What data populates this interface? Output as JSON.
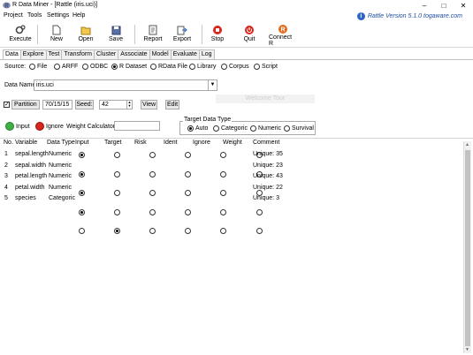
{
  "window": {
    "title": "R Data Miner - [Rattle (iris.uci)]"
  },
  "menu": [
    "Project",
    "Tools",
    "Settings",
    "Help"
  ],
  "rattle_version": "Rattle Version 5.1.0 togaware.com",
  "toolbar": {
    "execute": "Execute",
    "new": "New",
    "open": "Open",
    "save": "Save",
    "report": "Report",
    "export": "Export",
    "stop": "Stop",
    "quit": "Quit",
    "connect_r": "Connect R"
  },
  "tabs": [
    "Data",
    "Explore",
    "Test",
    "Transform",
    "Cluster",
    "Associate",
    "Model",
    "Evaluate",
    "Log"
  ],
  "source": {
    "label": "Source:",
    "options": [
      "File",
      "ARFF",
      "ODBC",
      "R Dataset",
      "RData File",
      "Library",
      "Corpus",
      "Script"
    ],
    "selected": "R Dataset"
  },
  "data_name": {
    "label": "Data Name:",
    "value": "iris.uci"
  },
  "welcome_tip": "Welcome Tour",
  "partition": {
    "label": "Partition",
    "value": "70/15/15",
    "seed_label": "Seed:",
    "seed_value": "42",
    "view": "View",
    "edit": "Edit"
  },
  "roles": {
    "input": "Input",
    "ignore": "Ignore",
    "weight_calc_label": "Weight Calculator:",
    "weight_calc_value": ""
  },
  "target_type": {
    "label": "Target Data Type",
    "options": [
      "Auto",
      "Categoric",
      "Numeric",
      "Survival"
    ],
    "selected": "Auto"
  },
  "grid": {
    "headers": [
      "No.",
      "Variable",
      "Data Type",
      "Input",
      "Target",
      "Risk",
      "Ident",
      "Ignore",
      "Weight",
      "Comment"
    ],
    "rows": [
      {
        "no": "1",
        "variable": "sepal.length",
        "type": "Numeric",
        "role": "Input",
        "comment": "Unique: 35"
      },
      {
        "no": "2",
        "variable": "sepal.width",
        "type": "Numeric",
        "role": "Input",
        "comment": "Unique: 23"
      },
      {
        "no": "3",
        "variable": "petal.length",
        "type": "Numeric",
        "role": "Input",
        "comment": "Unique: 43"
      },
      {
        "no": "4",
        "variable": "petal.width",
        "type": "Numeric",
        "role": "Input",
        "comment": "Unique: 22"
      },
      {
        "no": "5",
        "variable": "species",
        "type": "Categoric",
        "role": "Target",
        "comment": "Unique: 3"
      }
    ]
  },
  "colors": {
    "accent": "#2b63c8",
    "green": "#3cb043",
    "red": "#d9261c"
  }
}
